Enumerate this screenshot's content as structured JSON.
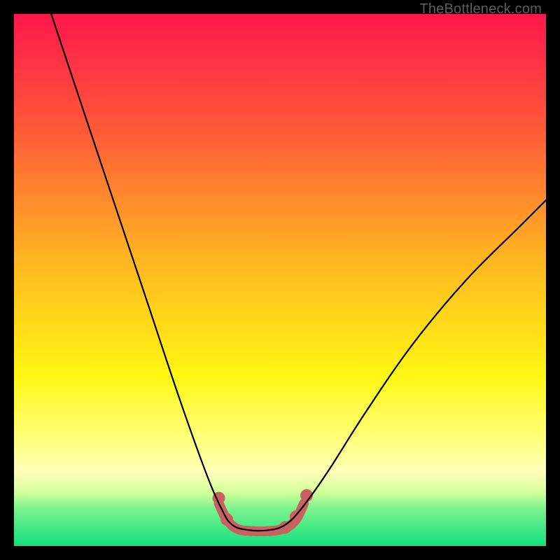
{
  "watermark": "TheBottleneck.com",
  "chart_data": {
    "type": "line",
    "title": "",
    "xlabel": "",
    "ylabel": "",
    "xlim": [
      0,
      100
    ],
    "ylim": [
      0,
      100
    ],
    "background_gradient": {
      "stops": [
        {
          "offset": 0.0,
          "color": "#ff174b"
        },
        {
          "offset": 0.22,
          "color": "#ff5a38"
        },
        {
          "offset": 0.45,
          "color": "#ffb222"
        },
        {
          "offset": 0.68,
          "color": "#fff713"
        },
        {
          "offset": 0.8,
          "color": "#ffff7e"
        },
        {
          "offset": 0.86,
          "color": "#ffffb8"
        },
        {
          "offset": 0.9,
          "color": "#d0ff9a"
        },
        {
          "offset": 0.93,
          "color": "#7bf38e"
        },
        {
          "offset": 1.0,
          "color": "#11e07e"
        }
      ]
    },
    "series": [
      {
        "name": "bottleneck-curve",
        "stroke": "#000000",
        "stroke_width": 2.2,
        "points": [
          {
            "x": 7,
            "y": 100
          },
          {
            "x": 12,
            "y": 85
          },
          {
            "x": 18,
            "y": 67
          },
          {
            "x": 25,
            "y": 46
          },
          {
            "x": 31,
            "y": 28
          },
          {
            "x": 36,
            "y": 14
          },
          {
            "x": 39,
            "y": 7
          },
          {
            "x": 41,
            "y": 4
          },
          {
            "x": 44,
            "y": 3
          },
          {
            "x": 48,
            "y": 3
          },
          {
            "x": 51,
            "y": 4
          },
          {
            "x": 54,
            "y": 7
          },
          {
            "x": 59,
            "y": 14
          },
          {
            "x": 66,
            "y": 25
          },
          {
            "x": 75,
            "y": 38
          },
          {
            "x": 85,
            "y": 50
          },
          {
            "x": 95,
            "y": 60
          },
          {
            "x": 100,
            "y": 65
          }
        ]
      },
      {
        "name": "highlight-valley",
        "stroke": "#c96163",
        "stroke_width": 14,
        "points": [
          {
            "x": 38.5,
            "y": 8
          },
          {
            "x": 40,
            "y": 5
          },
          {
            "x": 42,
            "y": 3.2
          },
          {
            "x": 45,
            "y": 2.8
          },
          {
            "x": 48,
            "y": 2.8
          },
          {
            "x": 51,
            "y": 3.4
          },
          {
            "x": 53,
            "y": 5
          },
          {
            "x": 54.5,
            "y": 8
          }
        ],
        "dots": [
          {
            "x": 38.5,
            "y": 9
          },
          {
            "x": 40,
            "y": 5
          },
          {
            "x": 51,
            "y": 3.5
          },
          {
            "x": 53,
            "y": 5.5
          },
          {
            "x": 55,
            "y": 9.5
          }
        ]
      }
    ]
  }
}
